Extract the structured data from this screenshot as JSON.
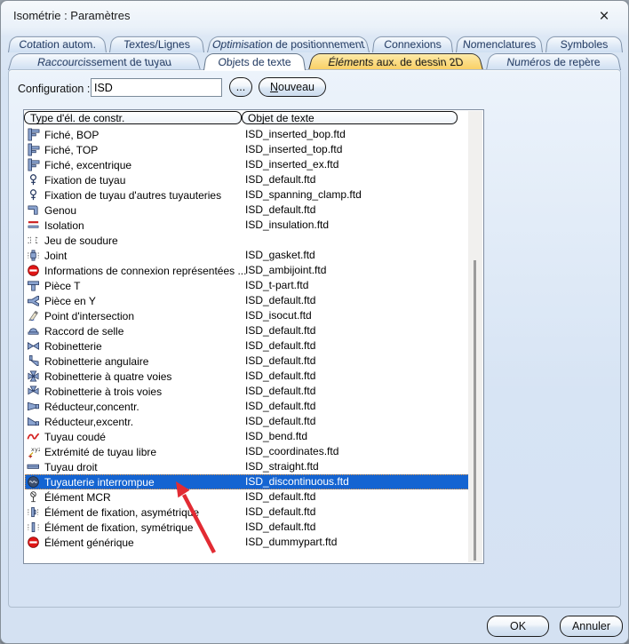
{
  "window": {
    "title": "Isométrie : Paramètres",
    "close_icon": "×"
  },
  "tabs_row1": [
    {
      "label": "Cotation autom."
    },
    {
      "label": "Textes/Lignes"
    },
    {
      "label": "Optimisation de positionnement"
    },
    {
      "label": "Connexions"
    },
    {
      "label": "Nomenclatures"
    },
    {
      "label": "Symboles"
    }
  ],
  "tabs_row2": [
    {
      "label": "Raccourcissement de tuyau",
      "state": "normal"
    },
    {
      "label": "Objets de texte",
      "state": "active"
    },
    {
      "label": "Éléments aux. de dessin 2D",
      "state": "highlighted"
    },
    {
      "label": "Numéros de repère",
      "state": "normal"
    }
  ],
  "config": {
    "label": "Configuration :",
    "value": "ISD",
    "browse_label": "...",
    "new_label": "Nouveau"
  },
  "list": {
    "columns": [
      "Type d'él. de constr.",
      "Objet de texte"
    ],
    "rows": [
      {
        "icon": "pipe-inserted-bop",
        "label": "Fiché, BOP",
        "value": "ISD_inserted_bop.ftd",
        "selected": false
      },
      {
        "icon": "pipe-inserted-top",
        "label": "Fiché, TOP",
        "value": "ISD_inserted_top.ftd",
        "selected": false
      },
      {
        "icon": "pipe-inserted-ex",
        "label": "Fiché, excentrique",
        "value": "ISD_inserted_ex.ftd",
        "selected": false
      },
      {
        "icon": "pipe-clamp",
        "label": "Fixation de tuyau",
        "value": "ISD_default.ftd",
        "selected": false
      },
      {
        "icon": "pipe-clamp",
        "label": "Fixation de tuyau d'autres tuyauteries",
        "value": "ISD_spanning_clamp.ftd",
        "selected": false
      },
      {
        "icon": "elbow",
        "label": "Genou",
        "value": "ISD_default.ftd",
        "selected": false
      },
      {
        "icon": "insulation",
        "label": "Isolation",
        "value": "ISD_insulation.ftd",
        "selected": false
      },
      {
        "icon": "weld-gap",
        "label": "Jeu de soudure",
        "value": "",
        "selected": false
      },
      {
        "icon": "gasket",
        "label": "Joint",
        "value": "ISD_gasket.ftd",
        "selected": false
      },
      {
        "icon": "no-entry",
        "label": "Informations de connexion représentées ...",
        "value": "ISD_ambijoint.ftd",
        "selected": false
      },
      {
        "icon": "tee",
        "label": "Pièce T",
        "value": "ISD_t-part.ftd",
        "selected": false
      },
      {
        "icon": "wye",
        "label": "Pièce en Y",
        "value": "ISD_default.ftd",
        "selected": false
      },
      {
        "icon": "isocut",
        "label": "Point d'intersection",
        "value": "ISD_isocut.ftd",
        "selected": false
      },
      {
        "icon": "saddle",
        "label": "Raccord de selle",
        "value": "ISD_default.ftd",
        "selected": false
      },
      {
        "icon": "valve",
        "label": "Robinetterie",
        "value": "ISD_default.ftd",
        "selected": false
      },
      {
        "icon": "valve-angle",
        "label": "Robinetterie angulaire",
        "value": "ISD_default.ftd",
        "selected": false
      },
      {
        "icon": "valve-4way",
        "label": "Robinetterie à quatre voies",
        "value": "ISD_default.ftd",
        "selected": false
      },
      {
        "icon": "valve-3way",
        "label": "Robinetterie à trois voies",
        "value": "ISD_default.ftd",
        "selected": false
      },
      {
        "icon": "reducer-conc",
        "label": "Réducteur,concentr.",
        "value": "ISD_default.ftd",
        "selected": false
      },
      {
        "icon": "reducer-ecc",
        "label": "Réducteur,excentr.",
        "value": "ISD_default.ftd",
        "selected": false
      },
      {
        "icon": "bend",
        "label": "Tuyau coudé",
        "value": "ISD_bend.ftd",
        "selected": false
      },
      {
        "icon": "xyz-coordinates",
        "label": "Extrémité de tuyau libre",
        "value": "ISD_coordinates.ftd",
        "selected": false
      },
      {
        "icon": "straight-pipe",
        "label": "Tuyau droit",
        "value": "ISD_straight.ftd",
        "selected": false
      },
      {
        "icon": "discontinuous-pipe",
        "label": "Tuyauterie interrompue",
        "value": "ISD_discontinuous.ftd",
        "selected": true
      },
      {
        "icon": "mcr-element",
        "label": "Élément MCR",
        "value": "ISD_default.ftd",
        "selected": false
      },
      {
        "icon": "fixation-asym",
        "label": "Élément de fixation, asymétrique",
        "value": "ISD_default.ftd",
        "selected": false
      },
      {
        "icon": "fixation-sym",
        "label": "Élément de fixation, symétrique",
        "value": "ISD_default.ftd",
        "selected": false
      },
      {
        "icon": "no-entry",
        "label": "Élément générique",
        "value": "ISD_dummypart.ftd",
        "selected": false
      }
    ]
  },
  "buttons": {
    "ok": "OK",
    "cancel": "Annuler"
  },
  "colors": {
    "selection_blue": "#1464d2",
    "highlight_tab_yellow": "#f9cf62",
    "arrow_red": "#e22b33",
    "dialog_blue": "#d6e3f3"
  }
}
